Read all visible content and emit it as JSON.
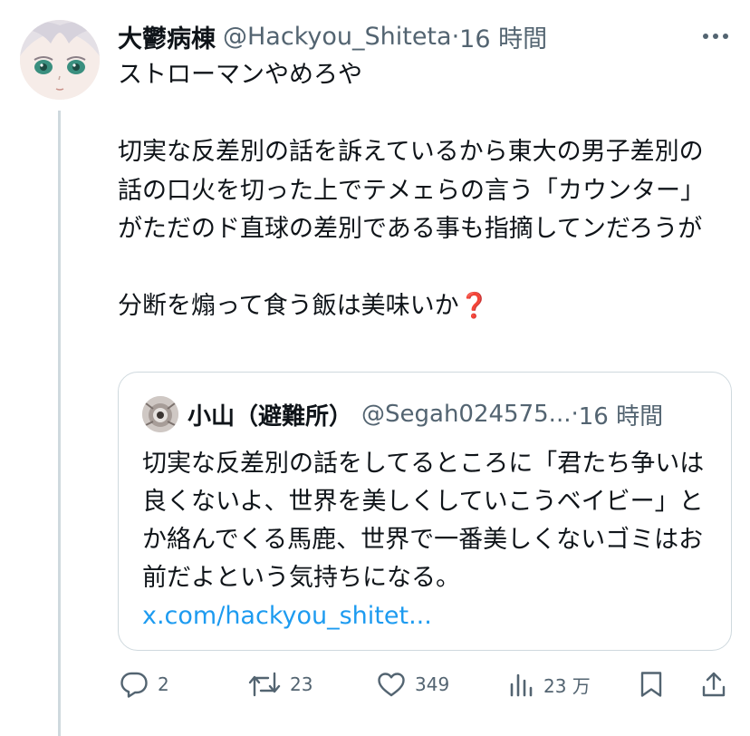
{
  "post": {
    "author_name": "大鬱病棟",
    "author_handle": "@Hackyou_Shiteta",
    "separator": "·",
    "time": "16 時間",
    "text": "ストローマンやめろや\n\n切実な反差別の話を訴えているから東大の男子差別の話の口火を切った上でテメェらの言う「カウンター」がただのド直球の差別である事も指摘してンだろうが\n\n分断を煽って食う飯は美味いか❓"
  },
  "quote": {
    "author_name": "小山（避難所）",
    "author_handle": "@Segah024575...",
    "separator": "·",
    "time": "16 時間",
    "text": "切実な反差別の話をしてるところに「君たち争いは良くないよ、世界を美しくしていこうベイビー」とか絡んでくる馬鹿、世界で一番美しくないゴミはお前だよという気持ちになる。",
    "link": "x.com/hackyou_shitet..."
  },
  "actions": {
    "replies": "2",
    "reposts": "23",
    "likes": "349",
    "views": "23 万"
  },
  "icons": {
    "more": "more-icon",
    "reply": "reply-icon",
    "repost": "repost-icon",
    "like": "heart-icon",
    "views": "views-icon",
    "bookmark": "bookmark-icon",
    "share": "share-icon"
  },
  "colors": {
    "text": "#0f1419",
    "secondary": "#536471",
    "link": "#1d9bf0",
    "border": "#cfd9de"
  }
}
